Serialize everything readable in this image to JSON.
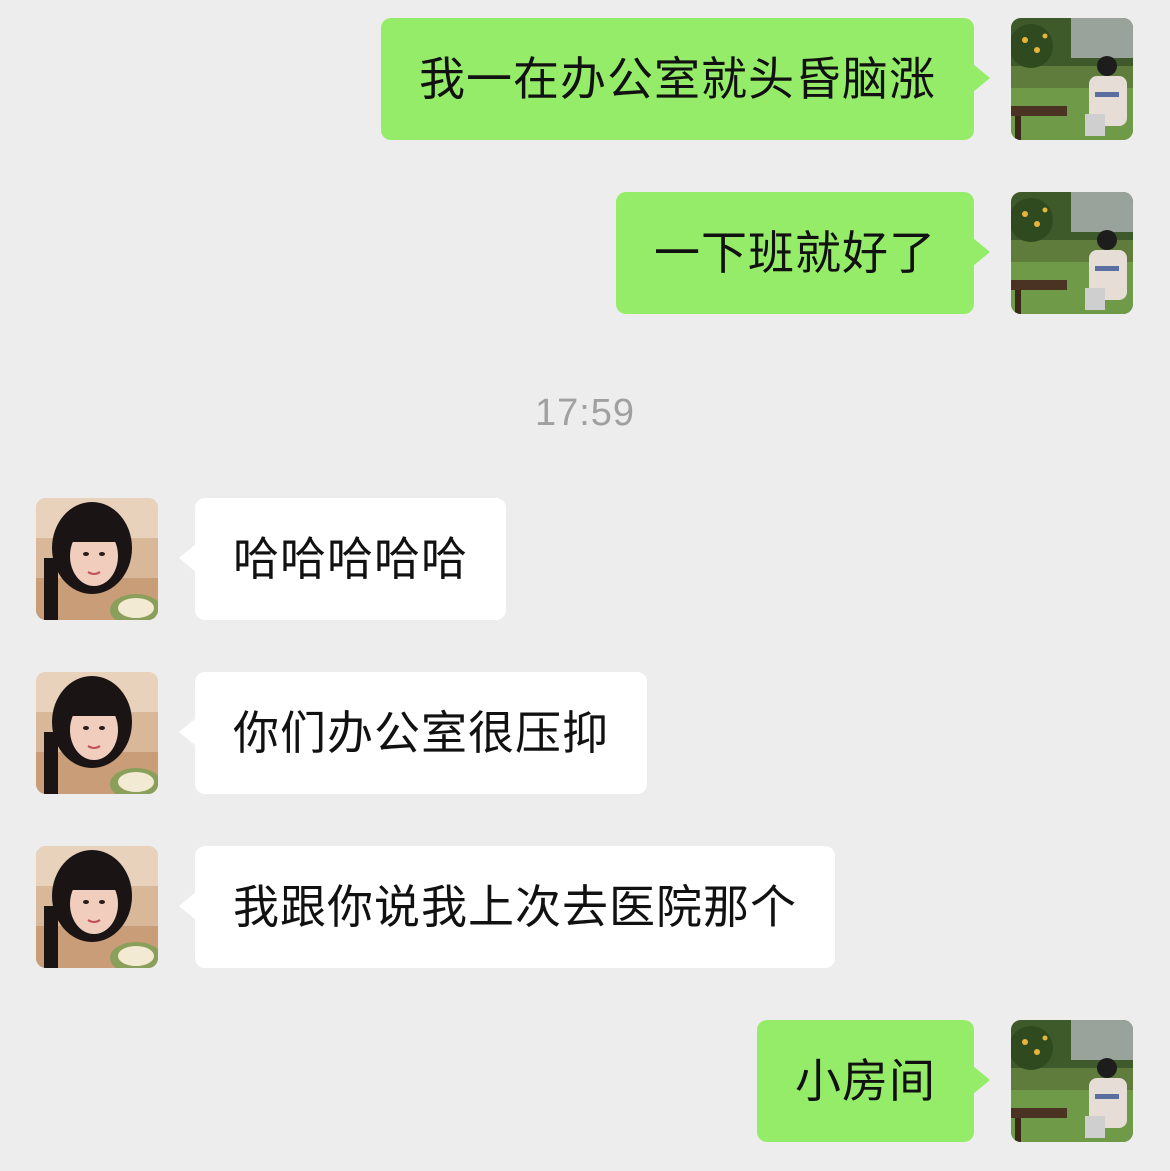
{
  "timestamp": "17:59",
  "colors": {
    "background": "#ededed",
    "my_bubble": "#95ec69",
    "their_bubble": "#ffffff",
    "timestamp_text": "#a0a0a0"
  },
  "messages": [
    {
      "sender": "me",
      "text": "我一在办公室就头昏脑涨"
    },
    {
      "sender": "me",
      "text": "一下班就好了"
    },
    {
      "sender": "them",
      "text": "哈哈哈哈哈"
    },
    {
      "sender": "them",
      "text": "你们办公室很压抑"
    },
    {
      "sender": "them",
      "text": "我跟你说我上次去医院那个"
    },
    {
      "sender": "me",
      "text": "小房间"
    }
  ]
}
